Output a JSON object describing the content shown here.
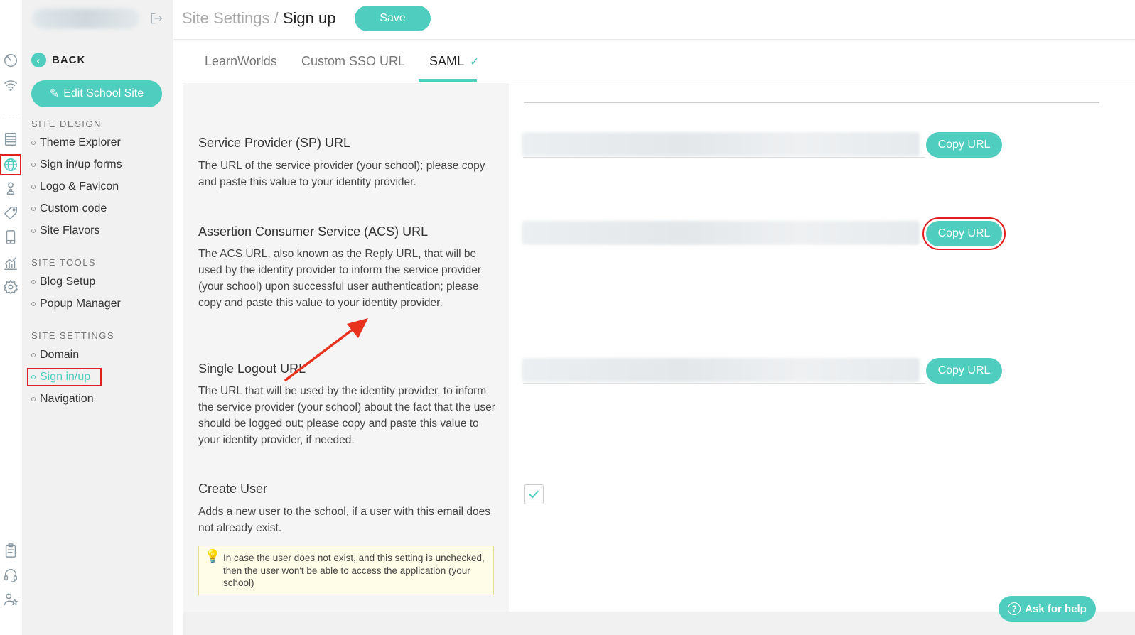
{
  "header": {
    "breadcrumb_parent": "Site Settings /",
    "breadcrumb_current": "Sign up",
    "save_label": "Save"
  },
  "sidebar": {
    "back_label": "BACK",
    "edit_button_label": "Edit School Site",
    "sections": [
      {
        "title": "SITE DESIGN",
        "items": [
          "Theme Explorer",
          "Sign in/up forms",
          "Logo & Favicon",
          "Custom code",
          "Site Flavors"
        ]
      },
      {
        "title": "SITE TOOLS",
        "items": [
          "Blog Setup",
          "Popup Manager"
        ]
      },
      {
        "title": "SITE SETTINGS",
        "items": [
          "Domain",
          "Sign in/up",
          "Navigation"
        ]
      }
    ],
    "active_item": "Sign in/up"
  },
  "rail_icons": [
    "dashboard-icon",
    "broadcast-icon",
    "pages-icon",
    "globe-icon",
    "users-icon",
    "tag-icon",
    "mobile-icon",
    "analytics-icon",
    "settings-icon",
    "clipboard-icon",
    "headset-icon",
    "affiliate-icon"
  ],
  "tabs": [
    {
      "label": "LearnWorlds",
      "active": false
    },
    {
      "label": "Custom SSO URL",
      "active": false
    },
    {
      "label": "SAML",
      "active": true,
      "check": "✓"
    }
  ],
  "sections": [
    {
      "title": "Service Provider (SP) URL",
      "description": "The URL of the service provider (your school); please copy and paste this value to your identity provider.",
      "button_label": "Copy URL"
    },
    {
      "title": "Assertion Consumer Service (ACS) URL",
      "description": "The ACS URL, also known as the Reply URL, that will be used by the identity provider to inform the service provider (your school) upon successful user authentication; please copy and paste this value to your identity provider.",
      "button_label": "Copy URL"
    },
    {
      "title": "Single Logout URL",
      "description": "The URL that will be used by the identity provider, to inform the service provider (your school) about the fact that the user should be logged out; please copy and paste this value to your identity provider, if needed.",
      "button_label": "Copy URL"
    },
    {
      "title": "Create User",
      "description": "Adds a new user to the school, if a user with this email does not already exist.",
      "checked": true
    }
  ],
  "tip": {
    "text": "In case the user does not exist, and this setting is unchecked, then the user won't be able to access the application (your school)"
  },
  "help_button_label": "Ask for help",
  "colors": {
    "accent": "#4fcdbf",
    "highlight": "#e02020",
    "arrow": "#e8321e"
  }
}
